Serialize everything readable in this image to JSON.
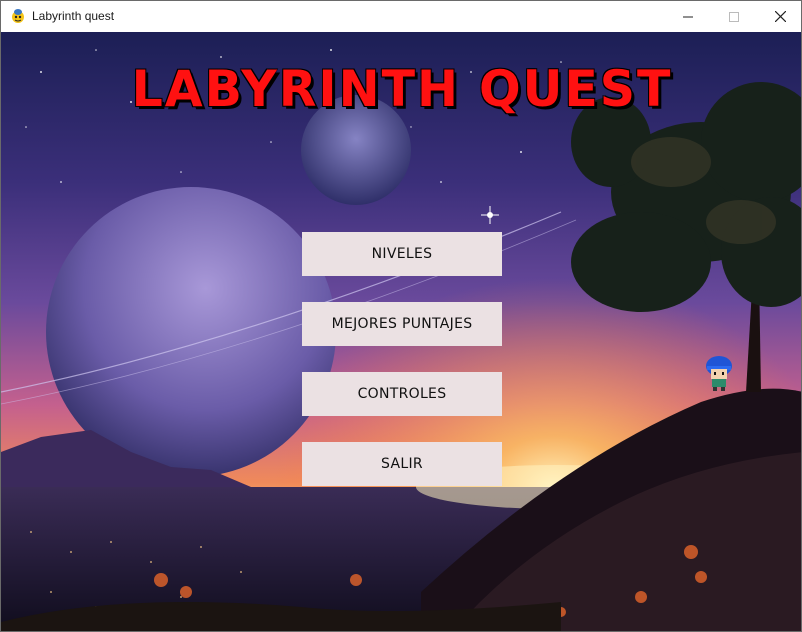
{
  "window": {
    "title": "Labyrinth quest",
    "controls": [
      "minimize-icon",
      "maximize-icon",
      "close-icon"
    ]
  },
  "game": {
    "title": "LABYRINTH QUEST",
    "title_color": "#ff1111"
  },
  "menu": {
    "buttons": [
      {
        "label": "NIVELES"
      },
      {
        "label": "MEJORES PUNTAJES"
      },
      {
        "label": "CONTROLES"
      },
      {
        "label": "SALIR"
      }
    ],
    "button_color": "#ebe1e3"
  },
  "icons": {
    "app": "pygame-snake-icon",
    "character": "player-character"
  }
}
